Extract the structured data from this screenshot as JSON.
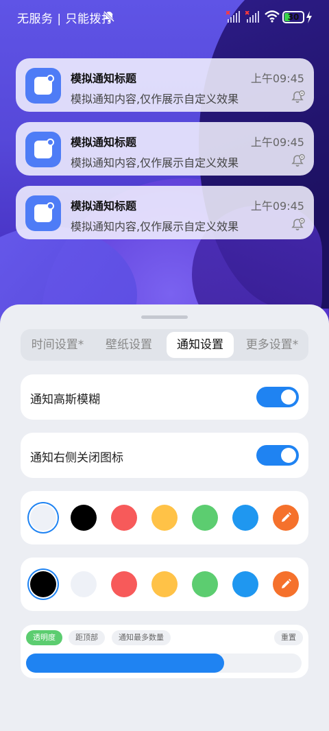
{
  "status_bar": {
    "carrier": "无服务 | 只能拨打",
    "battery_level": "30",
    "battery_fraction": 0.3
  },
  "notifications": [
    {
      "title": "模拟通知标题",
      "content": "模拟通知内容,仅作展示自定义效果",
      "time": "上午09:45"
    },
    {
      "title": "模拟通知标题",
      "content": "模拟通知内容,仅作展示自定义效果",
      "time": "上午09:45"
    },
    {
      "title": "模拟通知标题",
      "content": "模拟通知内容,仅作展示自定义效果",
      "time": "上午09:45"
    }
  ],
  "tabs": [
    {
      "label": "时间设置*",
      "active": false
    },
    {
      "label": "壁纸设置",
      "active": false
    },
    {
      "label": "通知设置",
      "active": true
    },
    {
      "label": "更多设置*",
      "active": false
    }
  ],
  "settings": {
    "blur_label": "通知高斯模糊",
    "blur_on": true,
    "close_icon_label": "通知右侧关闭图标",
    "close_icon_on": true
  },
  "palette_1": {
    "colors": [
      "#eef1f7",
      "#000000",
      "#f75a5a",
      "#ffc247",
      "#5ccd70",
      "#1f97f0"
    ],
    "selected_index": 0,
    "edit_color": "#f5712c",
    "edit_icon": "pencil-icon"
  },
  "palette_2": {
    "colors": [
      "#000000",
      "#eef1f7",
      "#f75a5a",
      "#ffc247",
      "#5ccd70",
      "#1f97f0"
    ],
    "selected_index": 0,
    "edit_color": "#f5712c",
    "edit_icon": "pencil-icon"
  },
  "slider": {
    "chips": [
      "透明度",
      "距顶部",
      "通知最多数量"
    ],
    "active_chip": 0,
    "reset_label": "重置",
    "value_fraction": 0.72
  },
  "colors": {
    "accent": "#1f83f2",
    "active_chip": "#5ccd70"
  }
}
